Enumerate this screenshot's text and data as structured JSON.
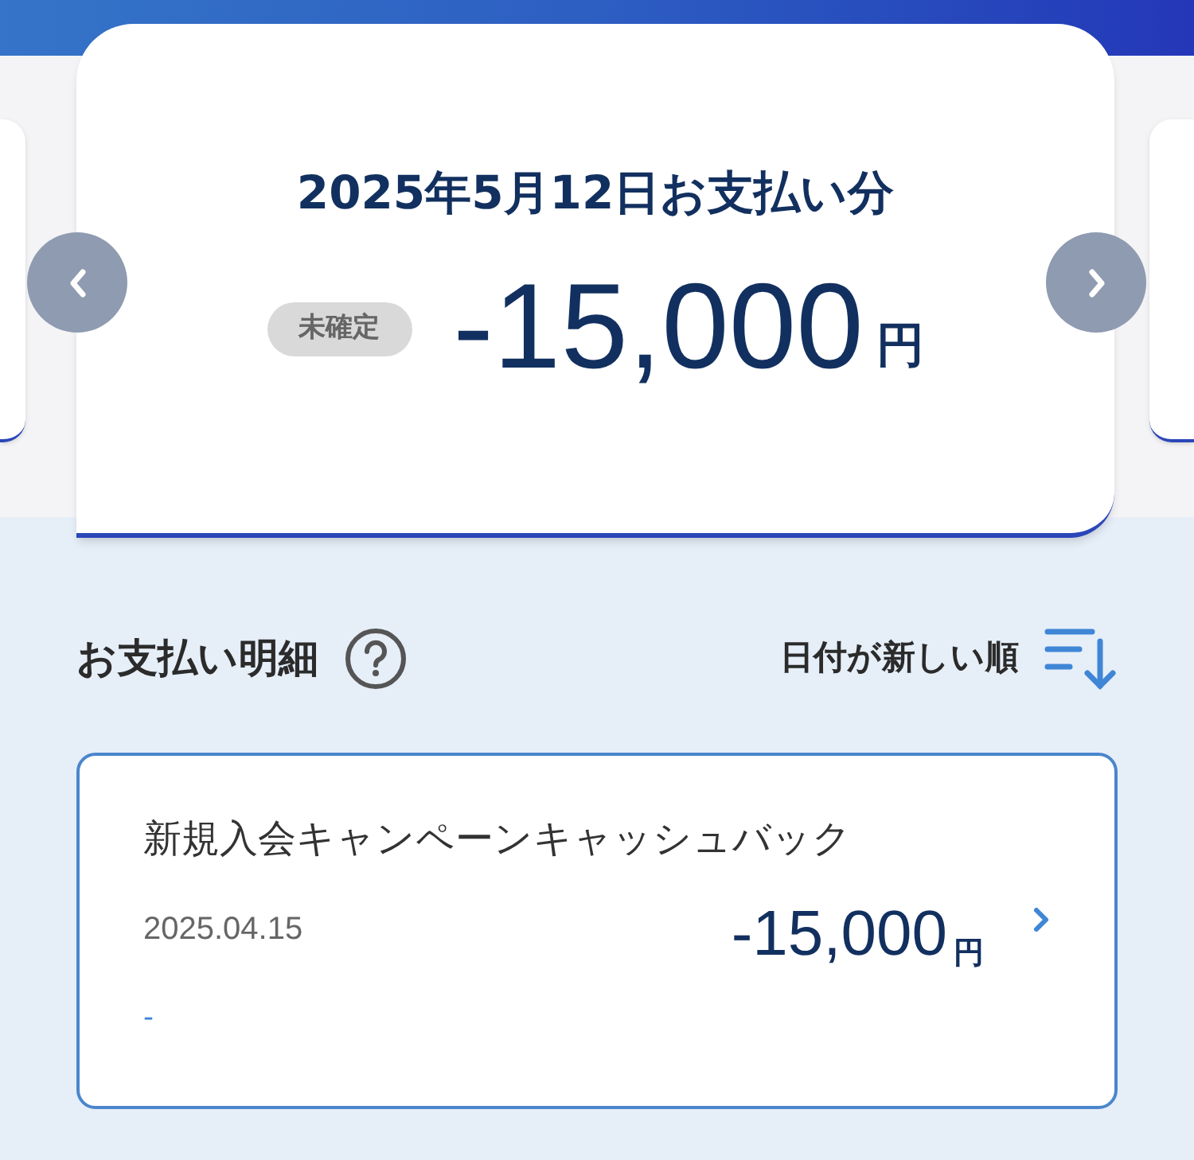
{
  "carousel": {
    "title": "2025年5月12日お支払い分",
    "status_badge": "未確定",
    "amount": "-15,000",
    "currency": "円"
  },
  "details": {
    "heading": "お支払い明細",
    "sort_label": "日付が新しい順",
    "items": [
      {
        "description": "新規入会キャンペーンキャッシュバック",
        "date": "2025.04.15",
        "amount": "-15,000",
        "currency": "円",
        "note": "-"
      }
    ]
  }
}
